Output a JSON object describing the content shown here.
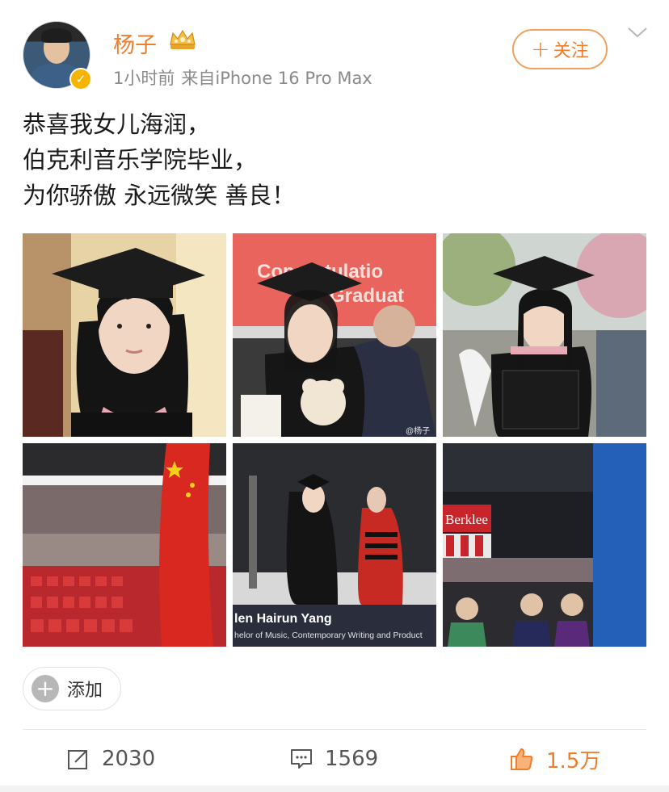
{
  "post": {
    "author": "杨子",
    "time": "1小时前",
    "source": "来自iPhone 16 Pro Max",
    "follow_label": "关注",
    "content_lines": [
      "恭喜我女儿海润，",
      "伯克利音乐学院毕业，",
      "为你骄傲 永远微笑 善良！"
    ]
  },
  "photos": {
    "p1": {
      "icon": "graduation-portrait"
    },
    "p2": {
      "banner_line1": "Congratulatio",
      "banner_line2": "Graduat",
      "watermark": "@杨子"
    },
    "p3": {
      "icon": "graduation-outdoor"
    },
    "p4": {
      "icon": "arena-with-flag"
    },
    "p5": {
      "caption_name": "len Hairun Yang",
      "caption_degree": "helor of Music, Contemporary Writing and Product"
    },
    "p6": {
      "banner": "Berklee"
    }
  },
  "add_label": "添加",
  "actions": {
    "share_count": "2030",
    "comment_count": "1569",
    "like_count": "1.5万"
  },
  "colors": {
    "accent": "#f07d2c",
    "verify": "#f5b400"
  }
}
